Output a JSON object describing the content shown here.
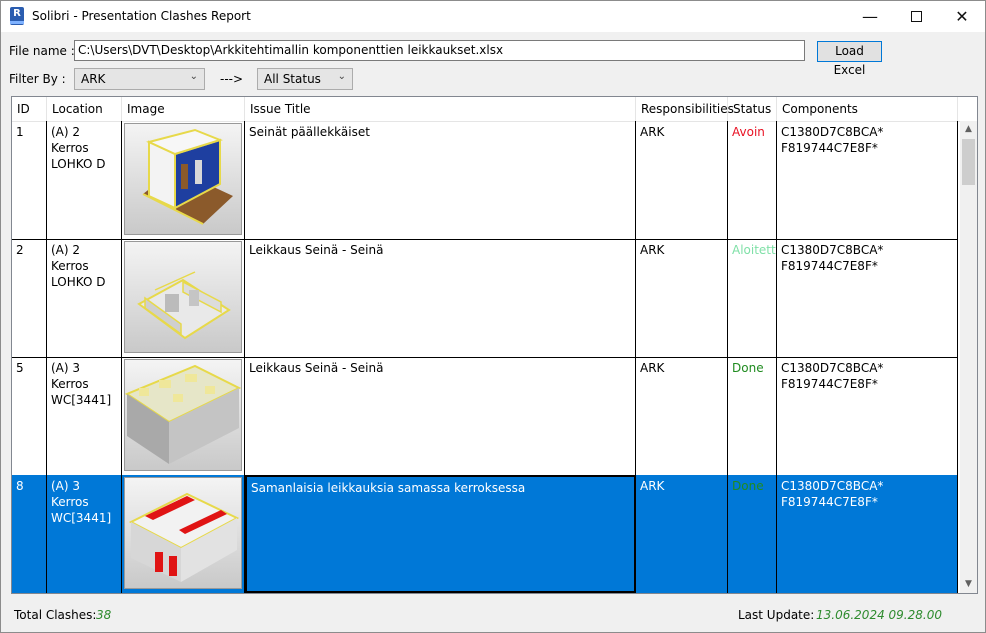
{
  "window": {
    "title": "Solibri - Presentation Clashes Report",
    "icon_letter": "R",
    "minimize_icon": "minimize-icon",
    "maximize_icon": "maximize-icon",
    "close_icon": "close-icon"
  },
  "file": {
    "label": "File name :",
    "value": "C:\\Users\\DVT\\Desktop\\Arkkitehtimallin komponenttien leikkaukset.xlsx",
    "load_button": "Load Excel"
  },
  "filter": {
    "label": "Filter By :",
    "responsibility_selected": "ARK",
    "arrow_text": "--->",
    "status_selected": "All Status"
  },
  "table": {
    "columns": [
      "ID",
      "Location",
      "Image",
      "Issue Title",
      "Responsibilities",
      "Status",
      "Components"
    ],
    "rows": [
      {
        "id": "1",
        "location": "(A) 2 Kerros LOHKO D",
        "issue_title": "Seinät päällekkäiset",
        "responsibility": "ARK",
        "status": "Avoin",
        "status_color": "#e81123",
        "components": "C1380D7C8BCA* F819744C7E8F*"
      },
      {
        "id": "2",
        "location": "(A) 2 Kerros LOHKO D",
        "issue_title": "Leikkaus Seinä - Seinä",
        "responsibility": "ARK",
        "status": "Aloitettu",
        "status_color": "#7fe0a7",
        "components": "C1380D7C8BCA* F819744C7E8F*"
      },
      {
        "id": "5",
        "location": "(A) 3 Kerros WC[3441]",
        "issue_title": "Leikkaus Seinä - Seinä",
        "responsibility": "ARK",
        "status": "Done",
        "status_color": "#1f8b1f",
        "components": "C1380D7C8BCA* F819744C7E8F*"
      },
      {
        "id": "8",
        "location": "(A) 3 Kerros WC[3441]",
        "issue_title": "Samanlaisia leikkauksia samassa kerroksessa",
        "responsibility": "ARK",
        "status": "Done",
        "status_color": "#1f8b1f",
        "components": "C1380D7C8BCA* F819744C7E8F*",
        "selected": true
      }
    ]
  },
  "footer": {
    "total_label": "Total Clashes:",
    "total_value": "38",
    "last_update_label": "Last Update:",
    "last_update_value": "13.06.2024 09.28.00"
  },
  "colors": {
    "selection": "#0078d7",
    "accent_green": "#2e8b2e"
  }
}
